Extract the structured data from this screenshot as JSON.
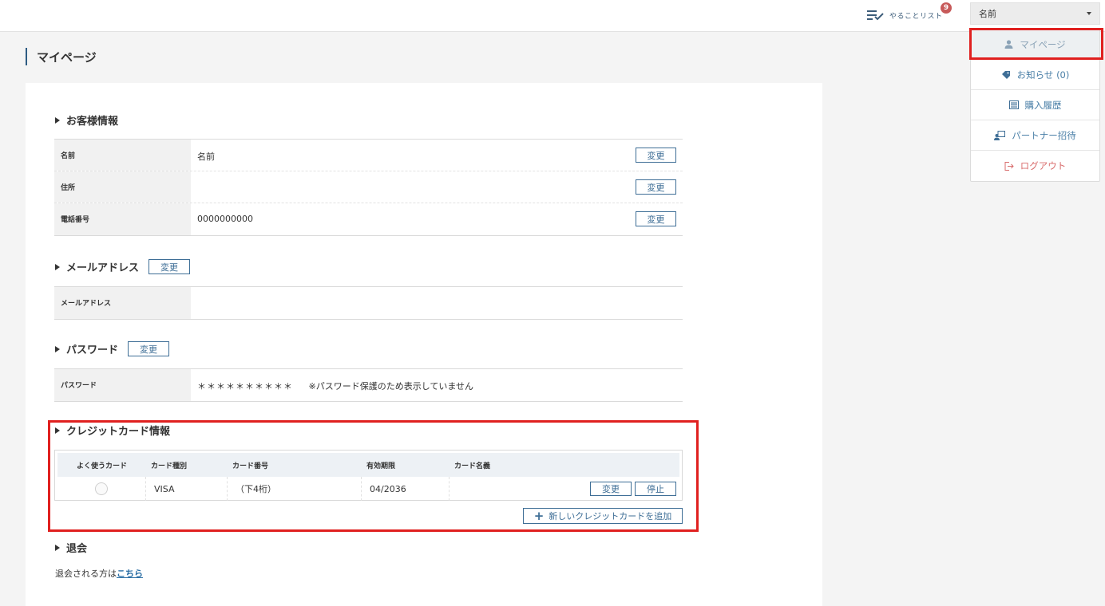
{
  "header": {
    "todo_label": "やることリスト",
    "todo_count": "9",
    "user_name": "名前"
  },
  "menu": {
    "items": [
      {
        "label": "マイページ",
        "icon": "person-icon"
      },
      {
        "label": "お知らせ (0)",
        "icon": "tag-icon"
      },
      {
        "label": "購入履歴",
        "icon": "list-icon"
      },
      {
        "label": "パートナー招待",
        "icon": "invite-icon"
      },
      {
        "label": "ログアウト",
        "icon": "logout-icon"
      }
    ]
  },
  "page": {
    "title": "マイページ"
  },
  "customer": {
    "title": "お客様情報",
    "change_label": "変更",
    "rows": [
      {
        "label": "名前",
        "value": "名前"
      },
      {
        "label": "住所",
        "value": ""
      },
      {
        "label": "電話番号",
        "value": "0000000000"
      }
    ]
  },
  "email": {
    "title": "メールアドレス",
    "change_label": "変更",
    "row_label": "メールアドレス",
    "row_value": ""
  },
  "password": {
    "title": "パスワード",
    "change_label": "変更",
    "row_label": "パスワード",
    "masked": "＊＊＊＊＊＊＊＊＊＊",
    "note": "※パスワード保護のため表示していません"
  },
  "credit": {
    "title": "クレジットカード情報",
    "headers": [
      "よく使うカード",
      "カード種別",
      "カード番号",
      "有効期限",
      "カード名義"
    ],
    "row": {
      "type": "VISA",
      "number": "（下4桁）",
      "expiry": "04/2036",
      "holder": ""
    },
    "change_label": "変更",
    "stop_label": "停止",
    "add_label": "新しいクレジットカードを追加"
  },
  "withdraw": {
    "title": "退会",
    "text": "退会される方は",
    "link": "こちら"
  },
  "colors": {
    "accent": "#3e6e96",
    "highlight": "#e0201f",
    "badge": "#c75a5a",
    "logout": "#d86b6b"
  }
}
